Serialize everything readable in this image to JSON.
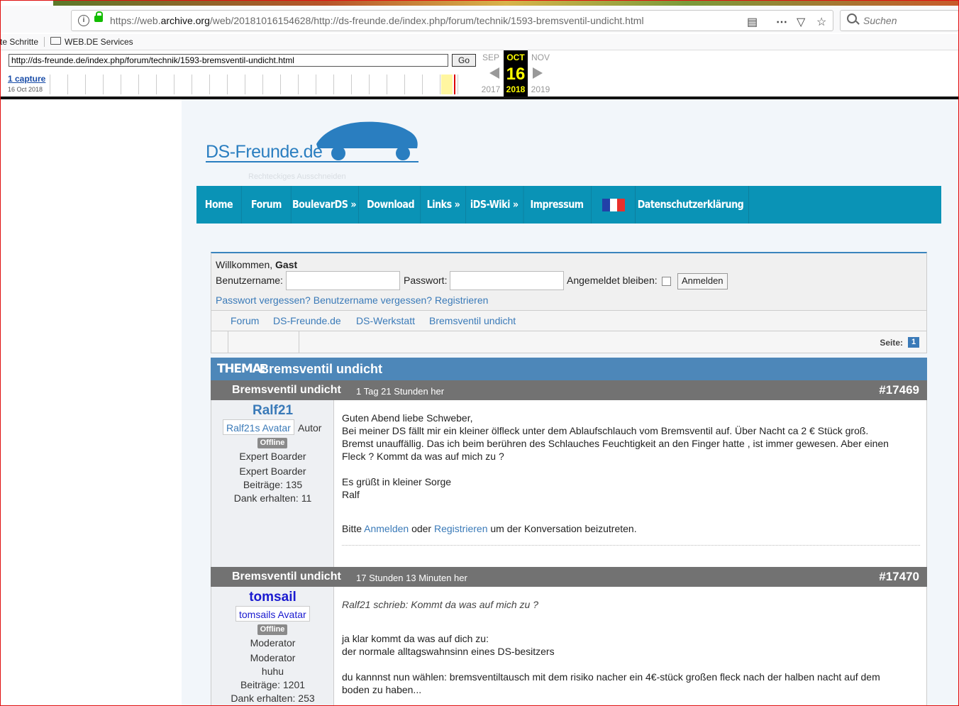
{
  "browser": {
    "url_prefix": "https://web.",
    "url_domain": "archive.org",
    "url_rest": "/web/20181016154628/http://ds-freunde.de/index.php/forum/technik/1593-bremsventil-undicht.html",
    "search_placeholder": "Suchen",
    "bookmarks": [
      "te Schritte",
      "WEB.DE Services"
    ]
  },
  "wayback": {
    "url_value": "http://ds-freunde.de/index.php/forum/technik/1593-bremsventil-undicht.html",
    "go_label": "Go",
    "captures": "1 capture",
    "capture_date": "16 Oct 2018",
    "prev_month": "SEP",
    "cur_month": "OCT",
    "next_month": "NOV",
    "day": "16",
    "prev_year": "2017",
    "cur_year": "2018",
    "next_year": "2019"
  },
  "site": {
    "logo_text": "DS-Freunde.de",
    "ghost_text": "Rechteckiges Ausschneiden",
    "colors": {
      "nav": "#0a93b6",
      "accent": "#4d87b9",
      "post_header": "#727272"
    },
    "nav": [
      {
        "label": "Home"
      },
      {
        "label": "Forum"
      },
      {
        "label": "BoulevarDS"
      },
      {
        "label": "Download"
      },
      {
        "label": "Links"
      },
      {
        "label": "iDS-Wiki"
      },
      {
        "label": "Impressum"
      },
      {
        "label": "Datenschutzerklärung"
      }
    ]
  },
  "login": {
    "welcome": "Willkommen,",
    "guest": "Gast",
    "username_label": "Benutzername:",
    "password_label": "Passwort:",
    "remember_label": "Angemeldet bleiben:",
    "login_button": "Anmelden",
    "links": "Passwort vergessen? Benutzername vergessen? Registrieren"
  },
  "breadcrumb": [
    "Forum",
    "DS-Freunde.de",
    "DS-Werkstatt",
    "Bremsventil undicht"
  ],
  "pager": {
    "label": "Seite:",
    "page": "1"
  },
  "topic": {
    "label": "THEMA:",
    "title": "Bremsventil undicht"
  },
  "posts": [
    {
      "title": "Bremsventil undicht",
      "time": "1 Tag 21 Stunden her",
      "id": "#17469",
      "user": "Ralf21",
      "user_color": "#3a7ab8",
      "avatar": "Ralf21s Avatar",
      "author_tag": "Autor",
      "status": "Offline",
      "rank1": "Expert Boarder",
      "rank2": "Expert Boarder",
      "posts_label": "Beiträge: 135",
      "thanks_label": "Dank erhalten: 11",
      "lines": [
        "Guten Abend liebe Schweber,",
        "Bei meiner DS fällt mir ein kleiner ölfleck unter dem Ablaufschlauch vom Bremsventil auf. Über Nacht ca 2 € Stück groß.",
        "Bremst unauffällig. Das ich beim berühren des Schlauches Feuchtigkeit an den Finger hatte , ist immer gewesen. Aber einen",
        "Fleck ? Kommt da was auf mich zu ?",
        "Es grüßt in kleiner Sorge",
        "Ralf"
      ],
      "join_pre": "Bitte",
      "join_login": "Anmelden",
      "join_mid": "oder",
      "join_register": "Registrieren",
      "join_post": "um der Konversation beizutreten."
    },
    {
      "title": "Bremsventil undicht",
      "time": "17 Stunden 13 Minuten her",
      "id": "#17470",
      "user": "tomsail",
      "user_color": "#1a1ad0",
      "avatar": "tomsails Avatar",
      "status": "Offline",
      "rank1": "Moderator",
      "rank2": "Moderator",
      "custom": "huhu",
      "posts_label": "Beiträge: 1201",
      "thanks_label": "Dank erhalten: 253",
      "quote": "Ralf21 schrieb: Kommt da was auf mich zu ?",
      "lines": [
        "ja klar kommt da was auf dich zu:",
        "der normale alltagswahnsinn eines DS-besitzers",
        "du kannnst nun wählen: bremsventiltausch mit dem risiko nacher ein 4€-stück großen fleck nach der halben nacht auf dem",
        "boden zu haben..."
      ]
    }
  ]
}
